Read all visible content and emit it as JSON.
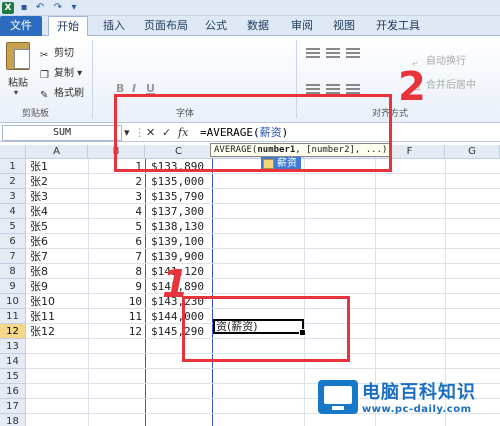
{
  "tabs": {
    "file": "文件",
    "items": [
      "开始",
      "插入",
      "页面布局",
      "公式",
      "数据",
      "审阅",
      "视图",
      "开发工具"
    ]
  },
  "ribbon": {
    "paste": "粘贴",
    "cut": "剪切",
    "copy": "复制",
    "format_painter": "格式刷",
    "clipboard_group": "剪贴板",
    "font_group": "字体",
    "align_group": "对齐方式",
    "wrap_text": "自动换行",
    "merge_center": "合并后居中"
  },
  "formula_bar": {
    "name_box": "SUM",
    "cancel": "✕",
    "enter": "✓",
    "fx": "fx",
    "formula_prefix": "=AVERAGE(",
    "formula_arg": "薪资",
    "formula_suffix": ")"
  },
  "tooltip": {
    "func": "AVERAGE(",
    "arg1": "number1",
    "rest": ", [number2], ...)"
  },
  "autocomplete": {
    "item": "薪资"
  },
  "columns": [
    "A",
    "B",
    "C",
    "D",
    "E",
    "F",
    "G"
  ],
  "rows": [
    {
      "n": "1",
      "name": "张1",
      "num": "1",
      "salary": "$133,890"
    },
    {
      "n": "2",
      "name": "张2",
      "num": "2",
      "salary": "$135,000"
    },
    {
      "n": "3",
      "name": "张3",
      "num": "3",
      "salary": "$135,790"
    },
    {
      "n": "4",
      "name": "张4",
      "num": "4",
      "salary": "$137,300"
    },
    {
      "n": "5",
      "name": "张5",
      "num": "5",
      "salary": "$138,130"
    },
    {
      "n": "6",
      "name": "张6",
      "num": "6",
      "salary": "$139,100"
    },
    {
      "n": "7",
      "name": "张7",
      "num": "7",
      "salary": "$139,900"
    },
    {
      "n": "8",
      "name": "张8",
      "num": "8",
      "salary": "$141,120"
    },
    {
      "n": "9",
      "name": "张9",
      "num": "9",
      "salary": "$141,890"
    },
    {
      "n": "10",
      "name": "张10",
      "num": "10",
      "salary": "$143,230"
    },
    {
      "n": "11",
      "name": "张11",
      "num": "11",
      "salary": "$144,000"
    },
    {
      "n": "12",
      "name": "张12",
      "num": "12",
      "salary": "$145,290"
    },
    {
      "n": "13",
      "name": "",
      "num": "",
      "salary": ""
    },
    {
      "n": "14",
      "name": "",
      "num": "",
      "salary": ""
    },
    {
      "n": "15",
      "name": "",
      "num": "",
      "salary": ""
    },
    {
      "n": "16",
      "name": "",
      "num": "",
      "salary": ""
    },
    {
      "n": "17",
      "name": "",
      "num": "",
      "salary": ""
    },
    {
      "n": "18",
      "name": "",
      "num": "",
      "salary": ""
    }
  ],
  "active_cell": {
    "text": "资(薪资)",
    "row": "12"
  },
  "annotations": {
    "one": "1",
    "two": "2"
  },
  "watermark": {
    "title": "电脑百科知识",
    "url": "www.pc-daily.com"
  },
  "colors": {
    "annotation": "#e8333a",
    "file_tab": "#2b6cbf",
    "watermark": "#1a6fc2"
  }
}
